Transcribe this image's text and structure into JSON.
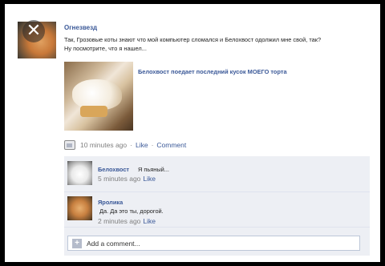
{
  "post": {
    "author": "Огнезвезд",
    "status_line1": "Так, Грозовые коты знают что мой компьютер сломался и Белохвост одолжил мне свой, так?",
    "status_line2": "Ну посмотрите, что я нашел...",
    "link_title": "Белохвост поедает последний кусок МОЕГО торта",
    "time": "10 minutes ago",
    "like_label": "Like",
    "comment_label": "Comment",
    "separator": "·"
  },
  "comments": [
    {
      "name": "Белохвост",
      "text": "Я пьяный...",
      "time": "5 minutes ago",
      "like_label": "Like"
    },
    {
      "name": "Яролика",
      "text": "Да. Да это ты, дорогой.",
      "time": "2 minutes ago",
      "like_label": "Like"
    }
  ],
  "add_comment": {
    "placeholder": "Add a comment..."
  },
  "icons": {
    "close": "close-icon",
    "photo": "photo-icon",
    "plus": "plus-icon"
  },
  "colors": {
    "link_blue": "#3b5998",
    "comment_bg": "#edeff4",
    "meta_gray": "#7f7f7f"
  }
}
